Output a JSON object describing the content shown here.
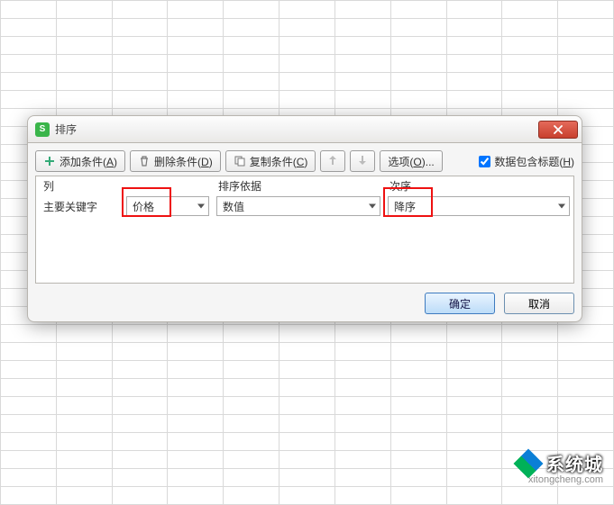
{
  "dialog": {
    "title": "排序",
    "icon_letter": "S",
    "toolbar": {
      "add": {
        "label": "添加条件",
        "hotkey": "A"
      },
      "delete": {
        "label": "删除条件",
        "hotkey": "D"
      },
      "copy": {
        "label": "复制条件",
        "hotkey": "C"
      },
      "options": {
        "label": "选项",
        "hotkey": "O"
      },
      "checkbox_label": "数据包含标题",
      "checkbox_hotkey": "H",
      "checkbox_checked": true
    },
    "headers": {
      "col": "列",
      "basis": "排序依据",
      "order": "次序"
    },
    "row": {
      "label": "主要关键字",
      "column_value": "价格",
      "basis_value": "数值",
      "order_value": "降序"
    },
    "footer": {
      "ok": "确定",
      "cancel": "取消"
    }
  },
  "watermark": {
    "brand": "系统城",
    "url": "xitongcheng.com"
  }
}
